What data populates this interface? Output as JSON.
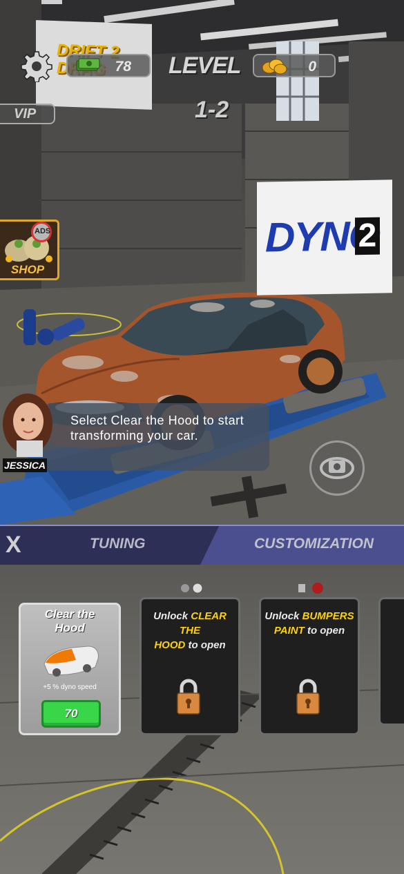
{
  "hud": {
    "cash": "78",
    "level_label": "LEVEL",
    "level_value": "1-2",
    "coins": "0",
    "vip_label": "VIP"
  },
  "shop": {
    "ads_label": "ADS",
    "label": "SHOP"
  },
  "scene": {
    "dyno_word": "DYNO",
    "dyno_num": "2",
    "poster_text": "DRIFT 2 DRAG"
  },
  "dialog": {
    "speaker": "JESSICA",
    "text": "Select Clear the Hood to start transforming your car."
  },
  "tabs": {
    "close_label": "X",
    "tuning": "TUNING",
    "customization": "CUSTOMIZATION",
    "active": "customization"
  },
  "cards": [
    {
      "title_line1": "Clear the",
      "title_line2": "Hood",
      "bonus": "+5 % dyno speed",
      "price": "70",
      "locked": false
    },
    {
      "prefix": "Unlock ",
      "req_line1": "CLEAR THE",
      "req_line2": "HOOD",
      "suffix": " to open",
      "locked": true
    },
    {
      "prefix": "Unlock ",
      "req_line1": "BUMPERS",
      "req_line2": "PAINT",
      "suffix": " to open",
      "locked": true
    }
  ],
  "colors": {
    "accent_yellow": "#ffd200",
    "price_green": "#39d64a",
    "tab_active": "#4c4f8f",
    "tab_inactive": "#2e2f56",
    "hood_orange": "#f07a00"
  }
}
